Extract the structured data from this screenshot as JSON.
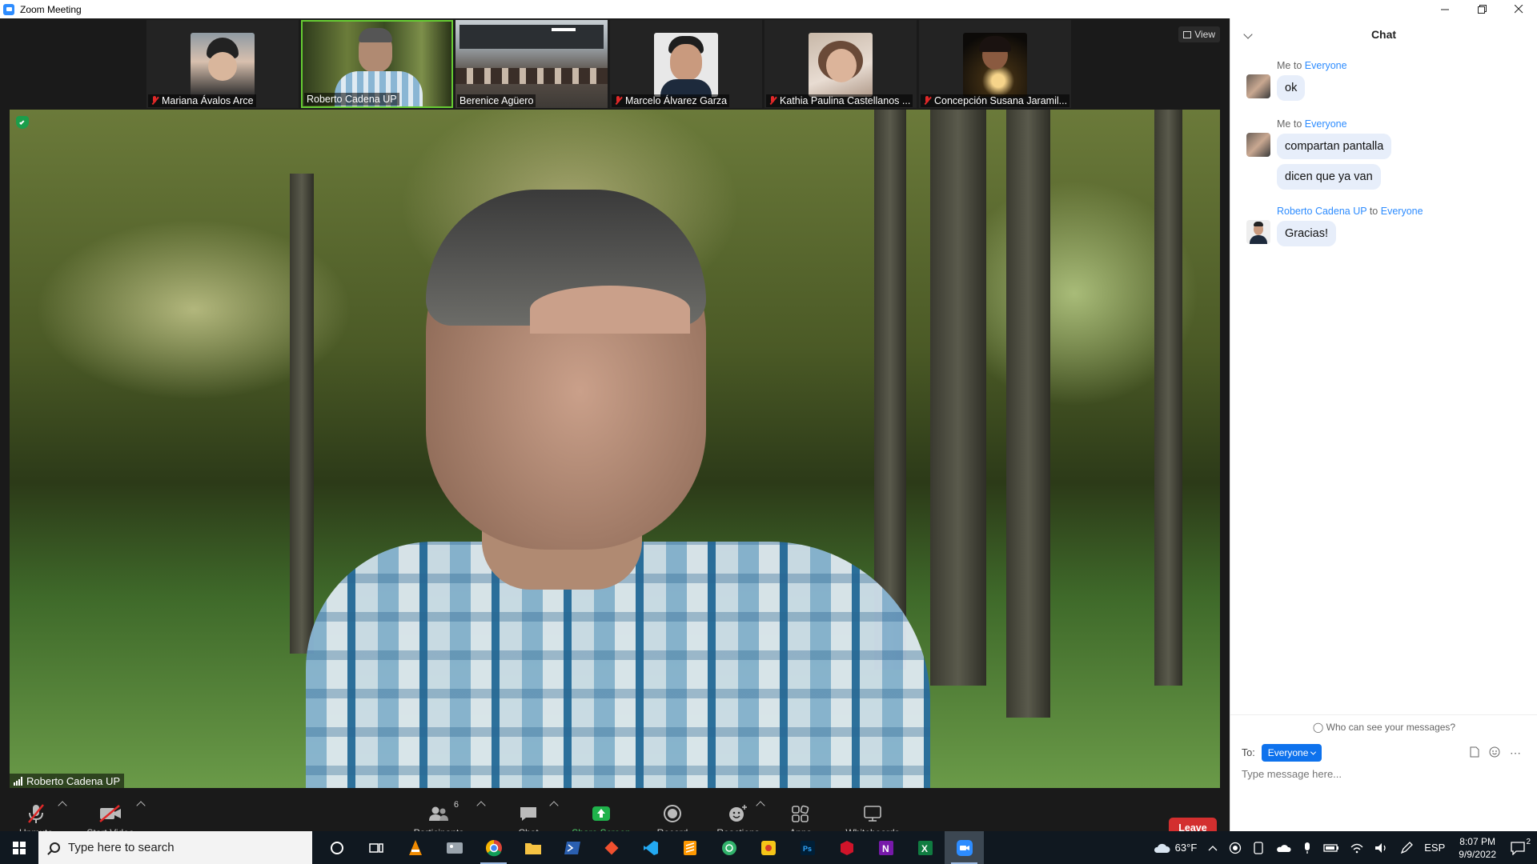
{
  "window": {
    "title": "Zoom Meeting",
    "controls": [
      "minimize",
      "restore",
      "close"
    ]
  },
  "participants_strip": [
    {
      "name": "Mariana Ávalos Arce",
      "muted": true,
      "type": "photo"
    },
    {
      "name": "Roberto Cadena UP",
      "muted": false,
      "type": "video",
      "active_speaker": true
    },
    {
      "name": "Berenice Agüero",
      "muted": false,
      "type": "video"
    },
    {
      "name": "Marcelo Álvarez Garza",
      "muted": true,
      "type": "photo"
    },
    {
      "name": "Kathia Paulina Castellanos ...",
      "muted": true,
      "type": "photo"
    },
    {
      "name": "Concepción Susana Jaramil...",
      "muted": true,
      "type": "photo"
    }
  ],
  "view_button": {
    "label": "View",
    "icon": "grid-icon"
  },
  "main_video": {
    "speaker_name": "Roberto Cadena UP",
    "encryption_icon": "shield-check-icon"
  },
  "toolbar": {
    "unmute": "Unmute",
    "start_video": "Start Video",
    "participants": "Participants",
    "participants_count": "6",
    "chat": "Chat",
    "share_screen": "Share Screen",
    "record": "Record",
    "reactions": "Reactions",
    "apps": "Apps",
    "whiteboards": "Whiteboards",
    "leave": "Leave"
  },
  "chat": {
    "title": "Chat",
    "messages": [
      {
        "from": "Me",
        "connector": "to",
        "to": "Everyone",
        "lines": [
          "ok"
        ]
      },
      {
        "from": "Me",
        "connector": "to",
        "to": "Everyone",
        "lines": [
          "compartan pantalla",
          "dicen que ya van"
        ]
      },
      {
        "from": "Roberto Cadena UP",
        "connector": "to",
        "to": "Everyone",
        "lines": [
          "Gracias!"
        ]
      }
    ],
    "who_can_see": "Who can see your messages?",
    "to_label": "To:",
    "recipient": "Everyone",
    "input_placeholder": "Type message here..."
  },
  "taskbar": {
    "search_placeholder": "Type here to search",
    "weather": "63°F",
    "language": "ESP",
    "time": "8:07 PM",
    "date": "9/9/2022",
    "notifications_count": "2"
  },
  "colors": {
    "accent": "#2d8cff",
    "leave": "#d32f2f",
    "share": "#1fb24b",
    "active_border": "#66cc33"
  }
}
